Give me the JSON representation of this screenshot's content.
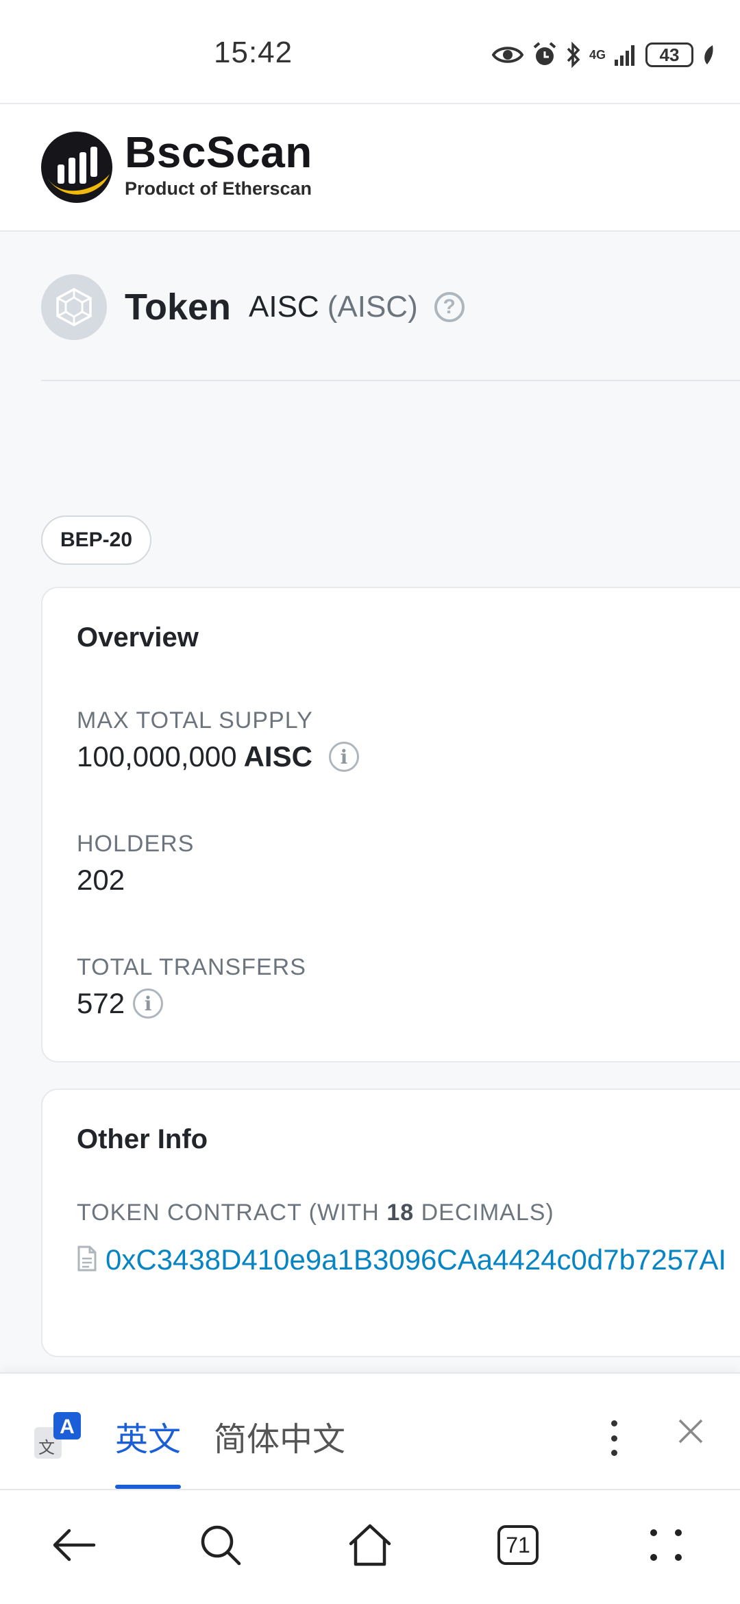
{
  "status_bar": {
    "time": "15:42",
    "network": "4G",
    "battery": "43",
    "icons": [
      "eye-icon",
      "alarm-icon",
      "bluetooth-icon",
      "signal-icon",
      "battery-icon",
      "leaf-icon"
    ]
  },
  "header": {
    "brand_name": "BscScan",
    "brand_sub": "Product of Etherscan",
    "colors": {
      "brand_dark": "#16161a",
      "brand_accent": "#f0b90b"
    }
  },
  "token": {
    "heading": "Token",
    "name": "AISC",
    "symbol": "(AISC)",
    "help_icon": "?"
  },
  "badge": {
    "label": "BEP-20"
  },
  "overview": {
    "title": "Overview",
    "max_supply_label": "MAX TOTAL SUPPLY",
    "max_supply_value": "100,000,000",
    "max_supply_unit": "AISC",
    "holders_label": "HOLDERS",
    "holders_value": "202",
    "transfers_label": "TOTAL TRANSFERS",
    "transfers_value": "572",
    "info_glyph": "i"
  },
  "other_info": {
    "title": "Other Info",
    "contract_label_prefix": "TOKEN CONTRACT (WITH",
    "decimals": "18",
    "contract_label_suffix": "DECIMALS)",
    "contract_address": "0xC3438D410e9a1B3096CAa4424c0d7b7257AI",
    "link_color": "#0784c3"
  },
  "translate_bar": {
    "tab_english": "英文",
    "tab_chinese": "简体中文",
    "translate_icon_letter": "A",
    "translate_icon_glyph": "文",
    "accent": "#1a5fd8"
  },
  "browser_nav": {
    "tab_count": "71"
  }
}
